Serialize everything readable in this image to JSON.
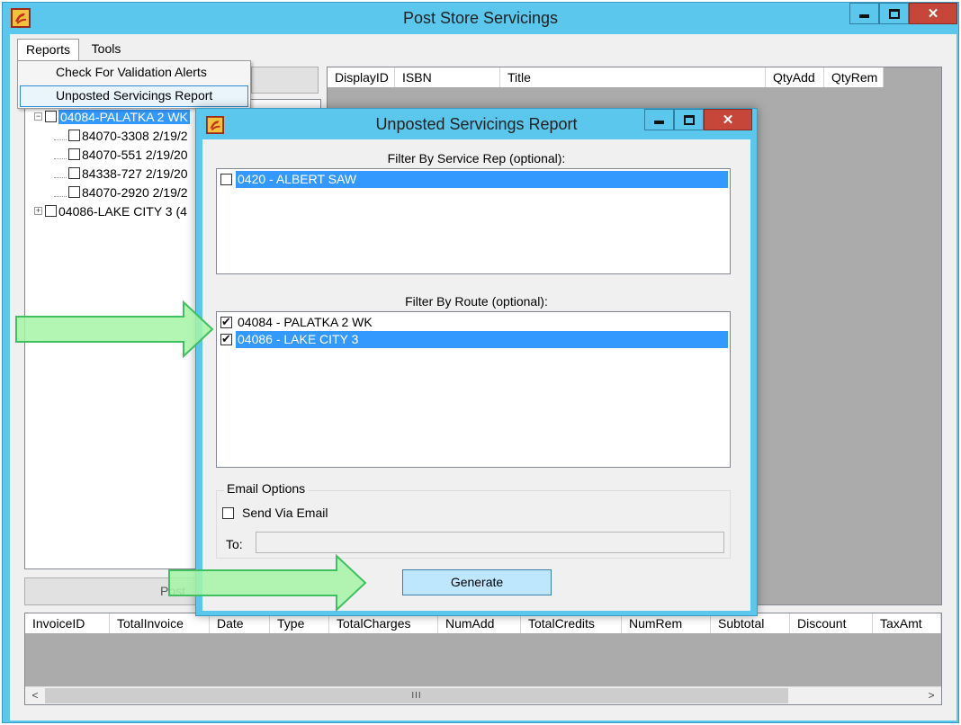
{
  "main_window": {
    "title": "Post Store Servicings",
    "icon": "app-logo-icon"
  },
  "menu": {
    "reports": "Reports",
    "tools": "Tools",
    "dropdown": [
      "Check For Validation Alerts",
      "Unposted Servicings Report"
    ]
  },
  "tree": {
    "items": [
      {
        "label": "04084-PALATKA 2 WK",
        "level": 0,
        "expanded": true,
        "selected": true
      },
      {
        "label": "84070-3308 2/19/2",
        "level": 1
      },
      {
        "label": "84070-551 2/19/20",
        "level": 1
      },
      {
        "label": "84338-727 2/19/20",
        "level": 1
      },
      {
        "label": "84070-2920 2/19/2",
        "level": 1
      },
      {
        "label": "04086-LAKE CITY  3 (4",
        "level": 0,
        "expanded": false
      }
    ]
  },
  "post_button": "Post",
  "right_grid": {
    "columns": [
      "DisplayID",
      "ISBN",
      "Title",
      "QtyAdd",
      "QtyRem"
    ]
  },
  "bottom_grid": {
    "columns": [
      "InvoiceID",
      "TotalInvoice",
      "Date",
      "Type",
      "TotalCharges",
      "NumAdd",
      "TotalCredits",
      "NumRem",
      "Subtotal",
      "Discount",
      "TaxAmt"
    ],
    "scroll_thumb": "III"
  },
  "dialog": {
    "title": "Unposted Servicings Report",
    "service_rep_label": "Filter By Service Rep (optional):",
    "service_reps": [
      {
        "label": "0420 - ALBERT SAW",
        "checked": false,
        "selected": true
      }
    ],
    "route_label": "Filter By Route (optional):",
    "routes": [
      {
        "label": "04084 - PALATKA 2 WK",
        "checked": true,
        "selected": false
      },
      {
        "label": "04086 - LAKE CITY  3",
        "checked": true,
        "selected": true
      }
    ],
    "email_options": {
      "legend": "Email Options",
      "send_via_email": "Send Via Email",
      "send_checked": false,
      "to_label": "To:",
      "to_value": ""
    },
    "generate_button": "Generate"
  },
  "colors": {
    "window_frame": "#5bc7ec",
    "close_button": "#c7463a",
    "selection": "#3399ff",
    "arrow_fill": "#a6f5a6",
    "arrow_stroke": "#3fbf5f"
  }
}
